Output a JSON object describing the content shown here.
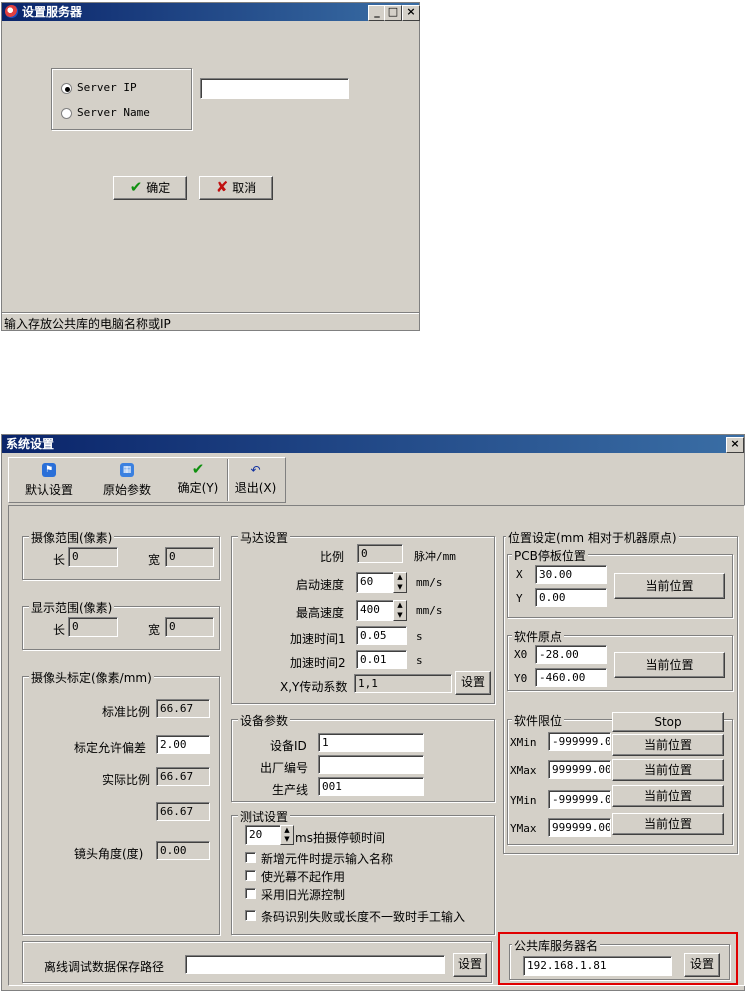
{
  "dialog1": {
    "title": "设置服务器",
    "controls": {
      "minimize": "_",
      "maximize": "□",
      "close": "×"
    },
    "radio_server_ip": "Server IP",
    "radio_server_name": "Server Name",
    "input_value": "",
    "ok_label": "确定",
    "cancel_label": "取消",
    "status_text": "输入存放公共库的电脑名称或IP"
  },
  "dialog2": {
    "title": "系统设置",
    "close": "×",
    "toolbar": {
      "default_settings": "默认设置",
      "original_params": "原始参数",
      "ok": "确定(Y)",
      "exit": "退出(X)"
    },
    "camera_range": {
      "title": "摄像范围(像素)",
      "length_label": "长",
      "length_value": "0",
      "width_label": "宽",
      "width_value": "0"
    },
    "display_range": {
      "title": "显示范围(像素)",
      "length_label": "长",
      "length_value": "0",
      "width_label": "宽",
      "width_value": "0"
    },
    "calibration": {
      "title": "摄像头标定(像素/mm)",
      "std_ratio_label": "标准比例",
      "std_ratio_value": "66.67",
      "tolerance_label": "标定允许偏差",
      "tolerance_value": "2.00",
      "actual_ratio_label": "实际比例",
      "actual_ratio_value": "66.67",
      "extra_value": "66.67",
      "lens_angle_label": "镜头角度(度)",
      "lens_angle_value": "0.00"
    },
    "motor": {
      "title": "马达设置",
      "ratio_label": "比例",
      "ratio_value": "0",
      "ratio_unit": "脉冲/mm",
      "start_speed_label": "启动速度",
      "start_speed_value": "60",
      "start_speed_unit": "mm/s",
      "max_speed_label": "最高速度",
      "max_speed_value": "400",
      "max_speed_unit": "mm/s",
      "accel1_label": "加速时间1",
      "accel1_value": "0.05",
      "accel1_unit": "s",
      "accel2_label": "加速时间2",
      "accel2_value": "0.01",
      "accel2_unit": "s",
      "xy_label": "X,Y传动系数",
      "xy_value": "1,1",
      "xy_button": "设置"
    },
    "device": {
      "title": "设备参数",
      "id_label": "设备ID",
      "id_value": "1",
      "serial_label": "出厂编号",
      "serial_value": "",
      "line_label": "生产线",
      "line_value": "001"
    },
    "test": {
      "title": "测试设置",
      "pause_value": "20",
      "pause_label": "ms拍摄停顿时间",
      "cb1": "新增元件时提示输入名称",
      "cb2": "使光幕不起作用",
      "cb3": "采用旧光源控制",
      "cb4": "条码识别失败或长度不一致时手工输入"
    },
    "position": {
      "title": "位置设定(mm 相对于机器原点)",
      "pcb_title": "PCB停板位置",
      "x_label": "X",
      "x_value": "30.00",
      "y_label": "Y",
      "y_value": "0.00",
      "pcb_button": "当前位置",
      "origin_title": "软件原点",
      "x0_label": "X0",
      "x0_value": "-28.00",
      "y0_label": "Y0",
      "y0_value": "-460.00",
      "origin_button": "当前位置",
      "limit_title": "软件限位",
      "stop_button": "Stop",
      "xmin_label": "XMin",
      "xmin_value": "-999999.00",
      "xmax_label": "XMax",
      "xmax_value": "999999.00",
      "ymin_label": "YMin",
      "ymin_value": "-999999.00",
      "ymax_label": "YMax",
      "ymax_value": "999999.00",
      "current_button": "当前位置"
    },
    "offline": {
      "label": "离线调试数据保存路径",
      "value": "",
      "button": "设置"
    },
    "public_server": {
      "title": "公共库服务器名",
      "value": "192.168.1.81",
      "button": "设置"
    }
  },
  "colors": {
    "titlebar": "#0a246a",
    "face": "#d4d0c8",
    "highlight_box": "#e00000"
  }
}
